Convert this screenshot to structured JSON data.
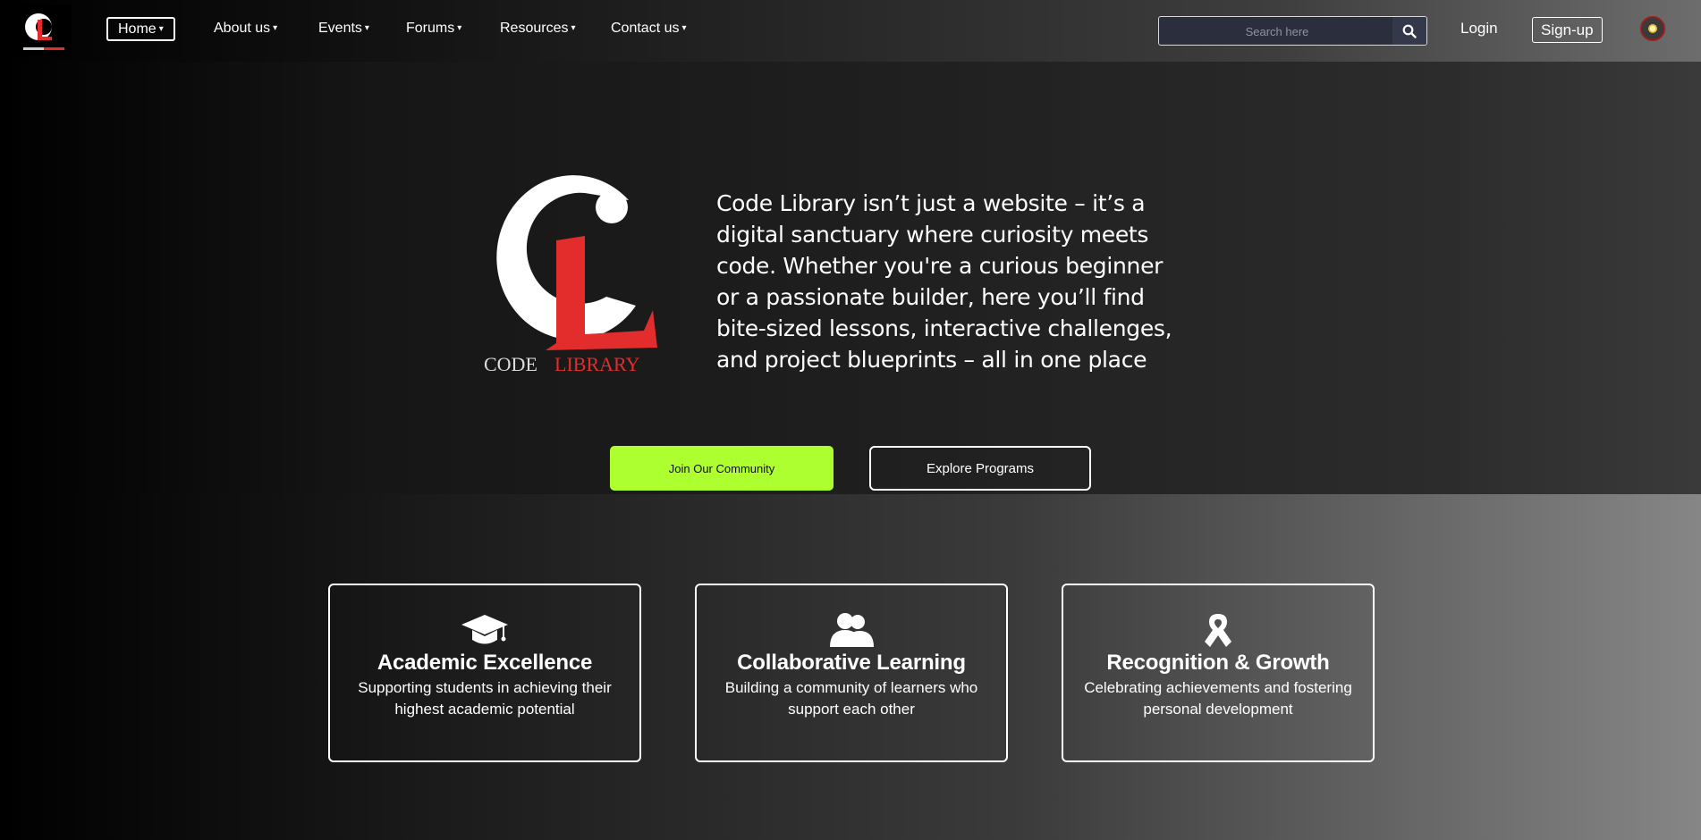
{
  "brand": {
    "logo_alt": "CL",
    "logo_caption": "CODE LIBRARY"
  },
  "nav": {
    "items": [
      {
        "label": "Home"
      },
      {
        "label": "About us"
      },
      {
        "label": "Events"
      },
      {
        "label": "Forums"
      },
      {
        "label": "Resources"
      },
      {
        "label": "Contact us"
      }
    ],
    "caret": "▾",
    "search_placeholder": "Search here",
    "login": "Login",
    "signup": "Sign-up"
  },
  "hero": {
    "logo_word_1": "CODE",
    "logo_word_2": "LIBRARY",
    "text": "Code Library isn’t just a website – it’s a digital sanctuary where curiosity meets code. Whether you're a curious beginner or a passionate builder, here you’ll find bite-sized lessons, interactive challenges, and project blueprints – all in one place",
    "join_button": "Join Our Community",
    "explore_button": "Explore Programs"
  },
  "features": [
    {
      "icon": "graduation-cap-icon",
      "title": "Academic Excellence",
      "desc": "Supporting students in achieving their highest academic potential"
    },
    {
      "icon": "users-icon",
      "title": "Collaborative Learning",
      "desc": "Building a community of learners who support each other"
    },
    {
      "icon": "ribbon-icon",
      "title": "Recognition & Growth",
      "desc": "Celebrating achievements and fostering personal development"
    }
  ],
  "colors": {
    "accent": "#adff2f",
    "logo_red": "#e32d2d"
  }
}
